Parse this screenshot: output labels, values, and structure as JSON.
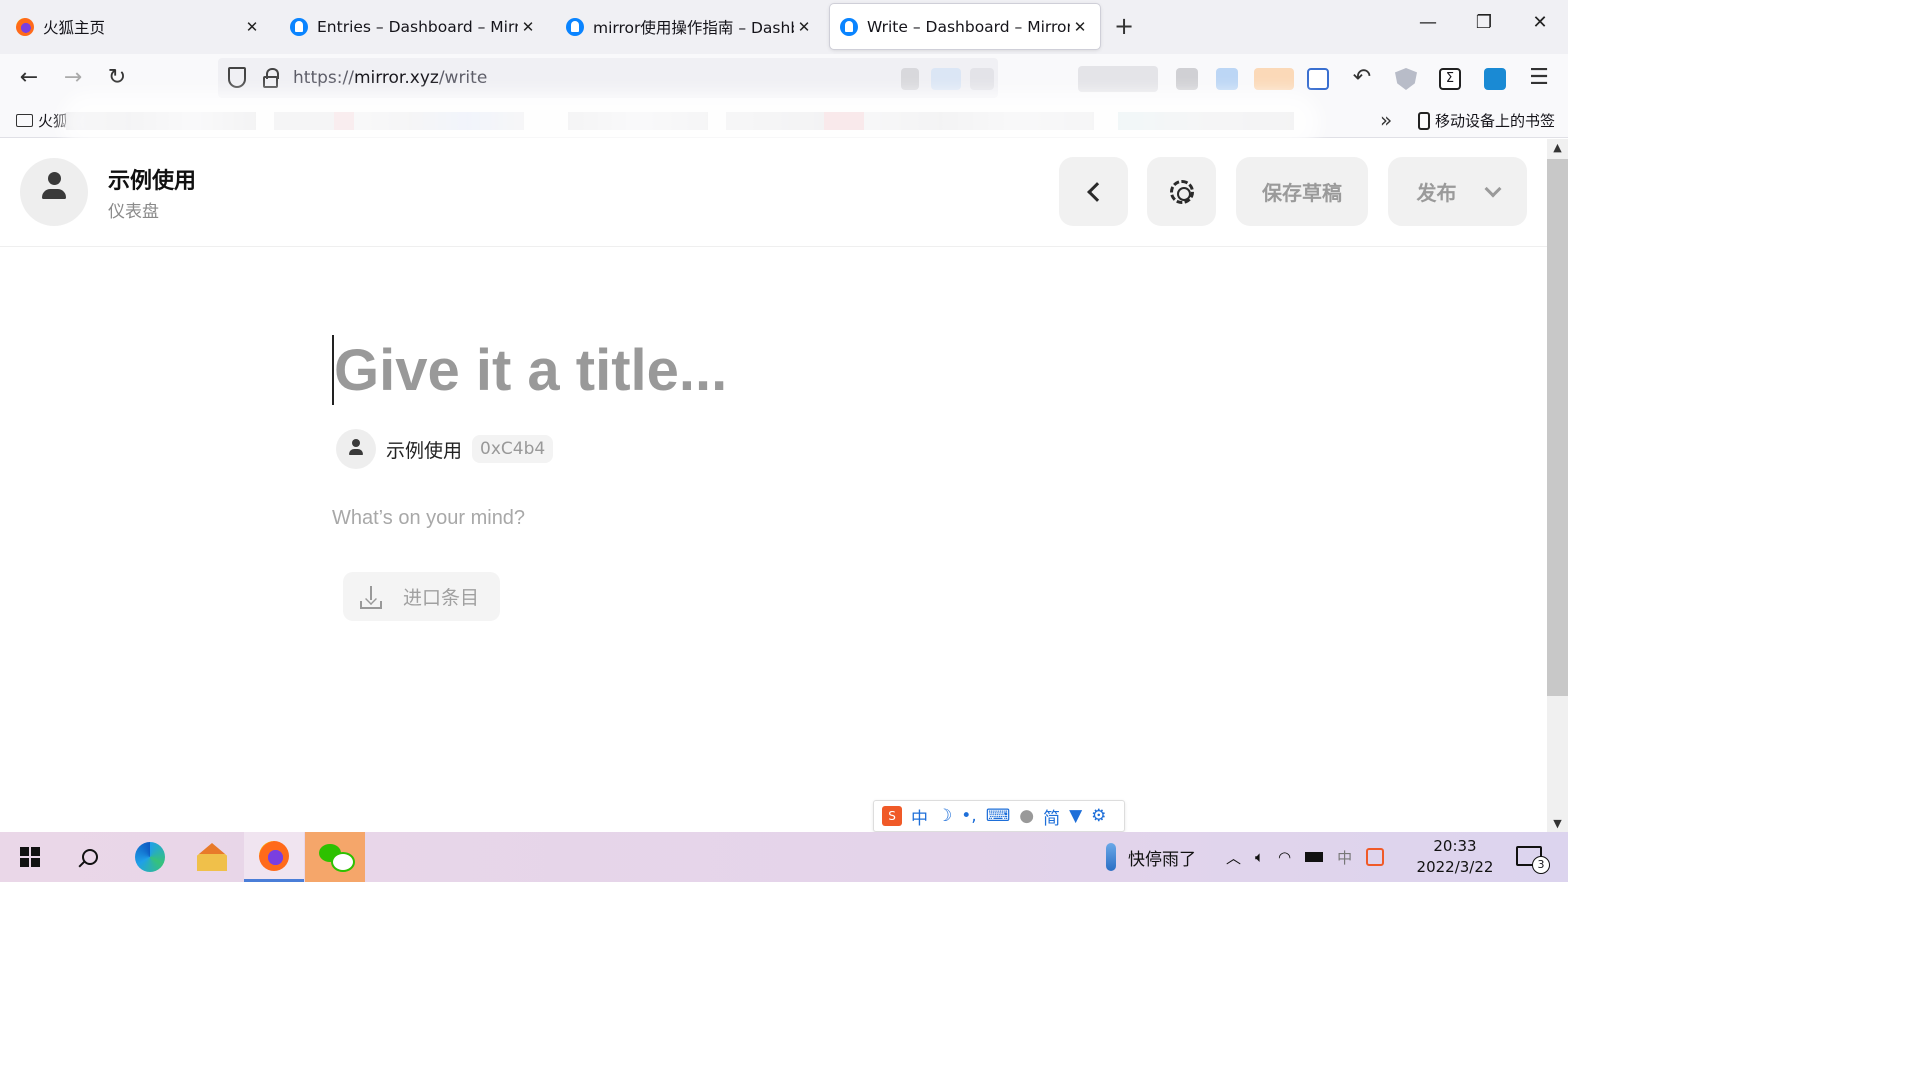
{
  "browser": {
    "tabs": [
      {
        "title": "火狐主页",
        "favicon": "firefox-icon",
        "active": false
      },
      {
        "title": "Entries – Dashboard – Mirror",
        "favicon": "mirror-icon",
        "active": false
      },
      {
        "title": "mirror使用操作指南 – Dashboard – Mirror",
        "favicon": "mirror-icon",
        "active": false
      },
      {
        "title": "Write – Dashboard – Mirror",
        "favicon": "mirror-icon",
        "active": true
      }
    ],
    "url_scheme": "https://",
    "url_host": "mirror.xyz",
    "url_path": "/write",
    "bookmarks": {
      "first_folder": "火狐",
      "mobile_bookmarks": "移动设备上的书签"
    }
  },
  "page": {
    "publication": {
      "name": "示例使用",
      "subtitle": "仪表盘"
    },
    "header_buttons": {
      "save_draft": "保存草稿",
      "publish": "发布"
    },
    "editor": {
      "title_placeholder": "Give it a title...",
      "author_name": "示例使用",
      "author_address": "0xC4b4",
      "body_placeholder": "What’s on your mind?",
      "import_label": "进口条目"
    }
  },
  "ime": {
    "mode": "中",
    "layout": "简"
  },
  "taskbar": {
    "weather_text": "快停雨了",
    "time": "20:33",
    "date": "2022/3/22",
    "notification_count": "3",
    "input_indicator": "中"
  },
  "colors": {
    "accent": "#0a84ff",
    "button_bg": "#f1f1f1",
    "muted_text": "#999999"
  }
}
